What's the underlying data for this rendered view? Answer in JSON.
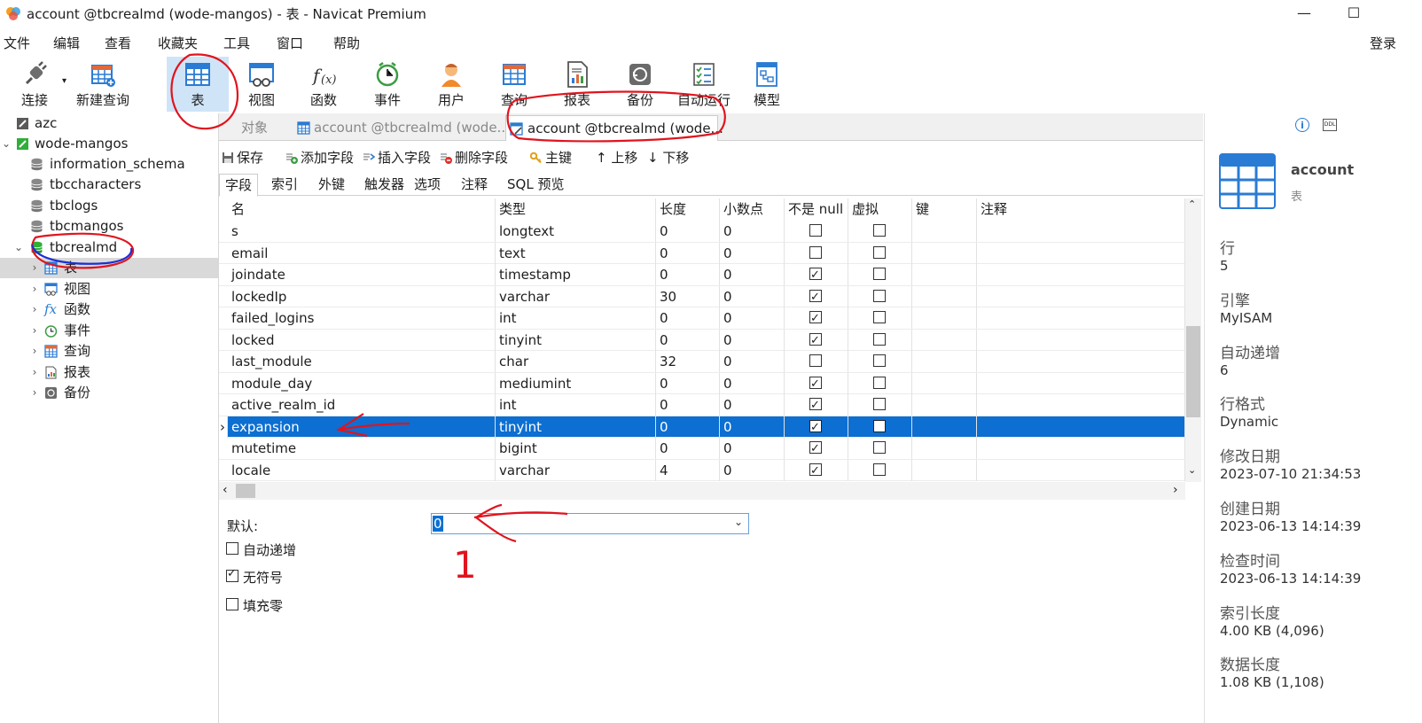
{
  "window": {
    "title": "account @tbcrealmd (wode-mangos) - 表 - Navicat Premium",
    "minimize_glyph": "—",
    "maximize_glyph": "☐"
  },
  "menu": {
    "items": [
      "文件",
      "编辑",
      "查看",
      "收藏夹",
      "工具",
      "窗口",
      "帮助"
    ],
    "login": "登录"
  },
  "toolbar": {
    "buttons": [
      {
        "label": "连接",
        "icon": "plug-icon"
      },
      {
        "label": "新建查询",
        "icon": "new-query-icon"
      },
      {
        "label": "表",
        "icon": "table-icon",
        "active": true
      },
      {
        "label": "视图",
        "icon": "view-icon"
      },
      {
        "label": "函数",
        "icon": "function-icon"
      },
      {
        "label": "事件",
        "icon": "clock-icon"
      },
      {
        "label": "用户",
        "icon": "user-icon"
      },
      {
        "label": "查询",
        "icon": "query-icon"
      },
      {
        "label": "报表",
        "icon": "report-icon"
      },
      {
        "label": "备份",
        "icon": "backup-icon"
      },
      {
        "label": "自动运行",
        "icon": "schedule-icon"
      },
      {
        "label": "模型",
        "icon": "model-icon"
      }
    ]
  },
  "tree": {
    "items": [
      {
        "label": "azc",
        "level": 0
      },
      {
        "label": "wode-mangos",
        "level": 0
      },
      {
        "label": "information_schema",
        "level": 1
      },
      {
        "label": "tbccharacters",
        "level": 1
      },
      {
        "label": "tbclogs",
        "level": 1
      },
      {
        "label": "tbcmangos",
        "level": 1
      },
      {
        "label": "tbcrealmd",
        "level": 1
      },
      {
        "label": "表",
        "level": 2
      },
      {
        "label": "视图",
        "level": 2
      },
      {
        "label": "函数",
        "level": 2
      },
      {
        "label": "事件",
        "level": 2
      },
      {
        "label": "查询",
        "level": 2
      },
      {
        "label": "报表",
        "level": 2
      },
      {
        "label": "备份",
        "level": 2
      }
    ]
  },
  "tabs": {
    "objects": "对象",
    "tab1": "account @tbcrealmd (wode...",
    "tab2": "account @tbcrealmd (wode..."
  },
  "edit_toolbar": {
    "save": "保存",
    "add_field": "添加字段",
    "insert_field": "插入字段",
    "delete_field": "删除字段",
    "primary_key": "主键",
    "move_up": "上移",
    "move_down": "下移"
  },
  "subtabs": [
    "字段",
    "索引",
    "外键",
    "触发器",
    "选项",
    "注释",
    "SQL 预览"
  ],
  "grid": {
    "headers": [
      "名",
      "类型",
      "长度",
      "小数点",
      "不是 null",
      "虚拟",
      "键",
      "注释"
    ],
    "rows": [
      {
        "name": "s",
        "type": "longtext",
        "length": "0",
        "decimal": "0",
        "not_null": false,
        "virtual": false
      },
      {
        "name": "email",
        "type": "text",
        "length": "0",
        "decimal": "0",
        "not_null": false,
        "virtual": false
      },
      {
        "name": "joindate",
        "type": "timestamp",
        "length": "0",
        "decimal": "0",
        "not_null": true,
        "virtual": false
      },
      {
        "name": "lockedIp",
        "type": "varchar",
        "length": "30",
        "decimal": "0",
        "not_null": true,
        "virtual": false
      },
      {
        "name": "failed_logins",
        "type": "int",
        "length": "0",
        "decimal": "0",
        "not_null": true,
        "virtual": false
      },
      {
        "name": "locked",
        "type": "tinyint",
        "length": "0",
        "decimal": "0",
        "not_null": true,
        "virtual": false
      },
      {
        "name": "last_module",
        "type": "char",
        "length": "32",
        "decimal": "0",
        "not_null": false,
        "virtual": false
      },
      {
        "name": "module_day",
        "type": "mediumint",
        "length": "0",
        "decimal": "0",
        "not_null": true,
        "virtual": false
      },
      {
        "name": "active_realm_id",
        "type": "int",
        "length": "0",
        "decimal": "0",
        "not_null": true,
        "virtual": false
      },
      {
        "name": "expansion",
        "type": "tinyint",
        "length": "0",
        "decimal": "0",
        "not_null": true,
        "virtual": false,
        "selected": true
      },
      {
        "name": "mutetime",
        "type": "bigint",
        "length": "0",
        "decimal": "0",
        "not_null": true,
        "virtual": false
      },
      {
        "name": "locale",
        "type": "varchar",
        "length": "4",
        "decimal": "0",
        "not_null": true,
        "virtual": false
      }
    ],
    "current_row_marker": "›"
  },
  "field_props": {
    "default_label": "默认:",
    "default_value": "0",
    "auto_increment": {
      "label": "自动递增",
      "checked": false
    },
    "unsigned": {
      "label": "无符号",
      "checked": true
    },
    "zerofill": {
      "label": "填充零",
      "checked": false
    }
  },
  "info": {
    "name": "account",
    "type": "表",
    "fields": [
      {
        "label": "行",
        "value": "5"
      },
      {
        "label": "引擎",
        "value": "MyISAM"
      },
      {
        "label": "自动递增",
        "value": "6"
      },
      {
        "label": "行格式",
        "value": "Dynamic"
      },
      {
        "label": "修改日期",
        "value": "2023-07-10 21:34:53"
      },
      {
        "label": "创建日期",
        "value": "2023-06-13 14:14:39"
      },
      {
        "label": "检查时间",
        "value": "2023-06-13 14:14:39"
      },
      {
        "label": "索引长度",
        "value": "4.00 KB (4,096)"
      },
      {
        "label": "数据长度",
        "value": "1.08 KB (1,108)"
      }
    ]
  },
  "annotations": {
    "mark_text": "1",
    "colors": {
      "red": "#e0141e",
      "blue": "#1a2fd8"
    }
  },
  "colors": {
    "selection": "#0c6fd1",
    "accent": "#2a7bd3"
  }
}
